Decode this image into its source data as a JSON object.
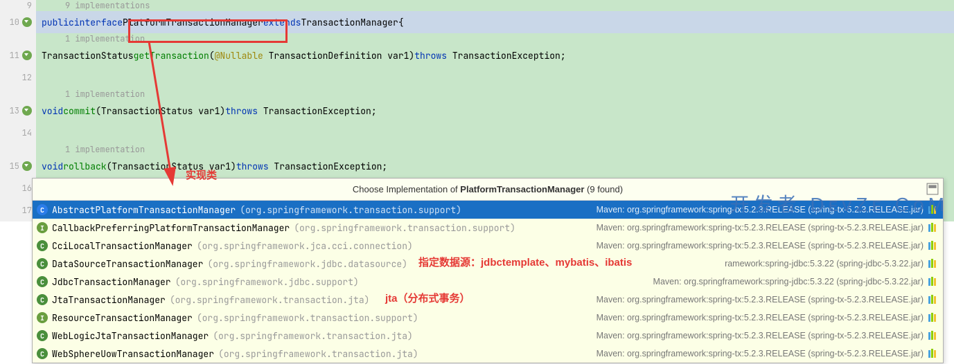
{
  "gutter": {
    "lines": [
      "9",
      "10",
      "11",
      "12",
      "13",
      "14",
      "15",
      "16",
      "17"
    ]
  },
  "code": {
    "hint9": "9 implementations",
    "line10": {
      "kw1": "public",
      "kw2": "interface",
      "name": "PlatformTransactionManager",
      "kw3": "extends",
      "parent": "TransactionManager",
      "brace": "{"
    },
    "hint11": "1 implementation",
    "line11": {
      "ret": "TransactionStatus",
      "method": "getTransaction",
      "p1": "(",
      "annot": "@Nullable",
      "params": " TransactionDefinition var1)",
      "kw": "throws",
      "exc": " TransactionException;"
    },
    "hint13": "1 implementation",
    "line13": {
      "ret": "void",
      "method": "commit",
      "params": "(TransactionStatus var1)",
      "kw": "throws",
      "exc": " TransactionException;"
    },
    "hint15": "1 implementation",
    "line15": {
      "ret": "void",
      "method": "rollback",
      "params": "(TransactionStatus var1)",
      "kw": "throws",
      "exc": " TransactionException;"
    },
    "line16": "}"
  },
  "popup": {
    "title_pre": "Choose Implementation of ",
    "title_bold": "PlatformTransactionManager",
    "title_post": " (9 found)",
    "rows": [
      {
        "icon": "C",
        "iconClass": "ci-cb",
        "name": "AbstractPlatformTransactionManager",
        "pkg": "(org.springframework.transaction.support)",
        "maven": "Maven: org.springframework:spring-tx:5.2.3.RELEASE (spring-tx-5.2.3.RELEASE.jar)",
        "sel": true
      },
      {
        "icon": "I",
        "iconClass": "ci-i",
        "name": "CallbackPreferringPlatformTransactionManager",
        "pkg": "(org.springframework.transaction.support)",
        "maven": "Maven: org.springframework:spring-tx:5.2.3.RELEASE (spring-tx-5.2.3.RELEASE.jar)"
      },
      {
        "icon": "C",
        "iconClass": "ci-c",
        "name": "CciLocalTransactionManager",
        "pkg": "(org.springframework.jca.cci.connection)",
        "maven": "Maven: org.springframework:spring-tx:5.2.3.RELEASE (spring-tx-5.2.3.RELEASE.jar)"
      },
      {
        "icon": "C",
        "iconClass": "ci-c",
        "name": "DataSourceTransactionManager",
        "pkg": "(org.springframework.jdbc.datasource)",
        "maven": "ramework:spring-jdbc:5.3.22 (spring-jdbc-5.3.22.jar)"
      },
      {
        "icon": "C",
        "iconClass": "ci-c",
        "name": "JdbcTransactionManager",
        "pkg": "(org.springframework.jdbc.support)",
        "maven": "Maven: org.springframework:spring-jdbc:5.3.22 (spring-jdbc-5.3.22.jar)"
      },
      {
        "icon": "C",
        "iconClass": "ci-c",
        "name": "JtaTransactionManager",
        "pkg": "(org.springframework.transaction.jta)",
        "maven": "Maven: org.springframework:spring-tx:5.2.3.RELEASE (spring-tx-5.2.3.RELEASE.jar)"
      },
      {
        "icon": "I",
        "iconClass": "ci-i",
        "name": "ResourceTransactionManager",
        "pkg": "(org.springframework.transaction.support)",
        "maven": "Maven: org.springframework:spring-tx:5.2.3.RELEASE (spring-tx-5.2.3.RELEASE.jar)"
      },
      {
        "icon": "C",
        "iconClass": "ci-c",
        "name": "WebLogicJtaTransactionManager",
        "pkg": "(org.springframework.transaction.jta)",
        "maven": "Maven: org.springframework:spring-tx:5.2.3.RELEASE (spring-tx-5.2.3.RELEASE.jar)"
      },
      {
        "icon": "C",
        "iconClass": "ci-c",
        "name": "WebSphereUowTransactionManager",
        "pkg": "(org.springframework.transaction.jta)",
        "maven": "Maven: org.springframework:spring-tx:5.2.3.RELEASE (spring-tx-5.2.3.RELEASE.jar)"
      }
    ]
  },
  "annotations": {
    "impl_class_label": "实现类",
    "datasource_label": "指定数据源：jdbctemplate、mybatis、ibatis",
    "jta_label": "jta（分布式事务）",
    "watermark": "开发者  DᴇᴠZᴇ.CᴏM"
  }
}
